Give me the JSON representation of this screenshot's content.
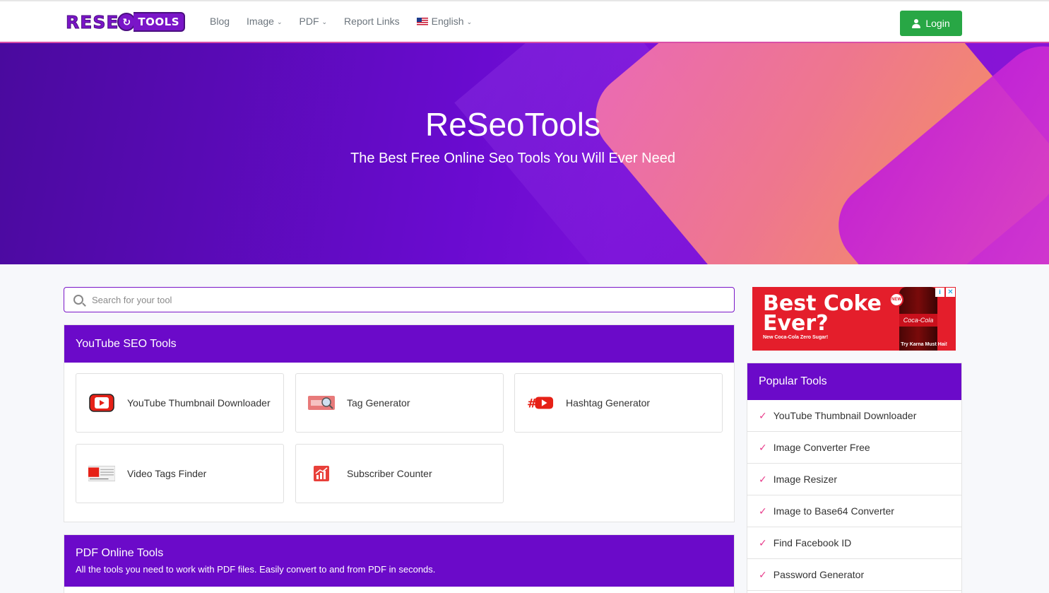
{
  "brand": {
    "logo_text_left": "RESE",
    "logo_text_right": "TOOLS"
  },
  "nav": {
    "items": [
      {
        "label": "Blog",
        "dropdown": false
      },
      {
        "label": "Image",
        "dropdown": true
      },
      {
        "label": "PDF",
        "dropdown": true
      },
      {
        "label": "Report Links",
        "dropdown": false
      },
      {
        "label": "English",
        "dropdown": true,
        "icon": "us-flag-icon"
      }
    ],
    "login_label": "Login"
  },
  "hero": {
    "title": "ReSeoTools",
    "subtitle": "The Best Free Online Seo Tools You Will Ever Need"
  },
  "search": {
    "placeholder": "Search for your tool",
    "value": ""
  },
  "youtube_section": {
    "title": "YouTube SEO Tools",
    "tools": [
      {
        "label": "YouTube Thumbnail Downloader",
        "icon": "youtube-play-icon"
      },
      {
        "label": "Tag Generator",
        "icon": "tag-search-icon"
      },
      {
        "label": "Hashtag Generator",
        "icon": "hashtag-youtube-icon"
      },
      {
        "label": "Video Tags Finder",
        "icon": "video-tags-icon"
      },
      {
        "label": "Subscriber Counter",
        "icon": "chart-icon"
      }
    ]
  },
  "pdf_section": {
    "title": "PDF Online Tools",
    "description": "All the tools you need to work with PDF files. Easily convert to and from PDF in seconds."
  },
  "ad": {
    "headline_line1": "Best Coke",
    "headline_line2": "Ever?",
    "subline_left": "New Coca-Cola Zero Sugar!",
    "subline_right": "Try Karna Must Hai!",
    "bottle_label": "Coca-Cola",
    "badge": "NEW"
  },
  "popular": {
    "title": "Popular Tools",
    "items": [
      "YouTube Thumbnail Downloader",
      "Image Converter Free",
      "Image Resizer",
      "Image to Base64 Converter",
      "Find Facebook ID",
      "Password Generator"
    ]
  },
  "colors": {
    "brand_purple": "#6b0ac9",
    "login_green": "#28a745",
    "check_pink": "#e83e8c"
  }
}
